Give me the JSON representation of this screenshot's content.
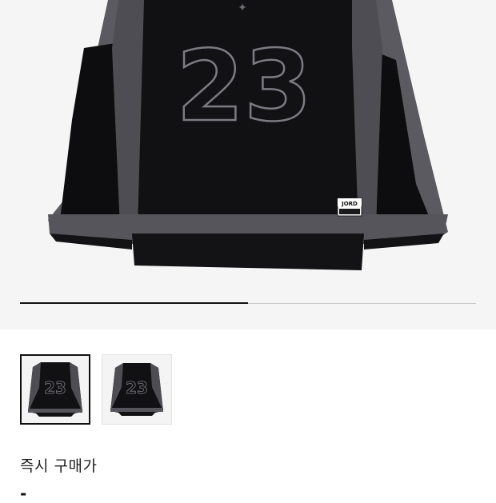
{
  "product": {
    "jersey_number": "23",
    "tag_text": "JORD",
    "images": [
      {
        "name": "jersey-front-image",
        "selected": true
      },
      {
        "name": "jersey-front-image-2",
        "selected": false
      }
    ]
  },
  "gallery": {
    "progress": 0.5
  },
  "purchase": {
    "instant_buy_label": "즉시 구매가",
    "price_value": "-"
  },
  "colors": {
    "jersey_black": "#0d0d10",
    "mesh_grey": "#5a5a60",
    "hero_bg": "#f5f5f5"
  }
}
